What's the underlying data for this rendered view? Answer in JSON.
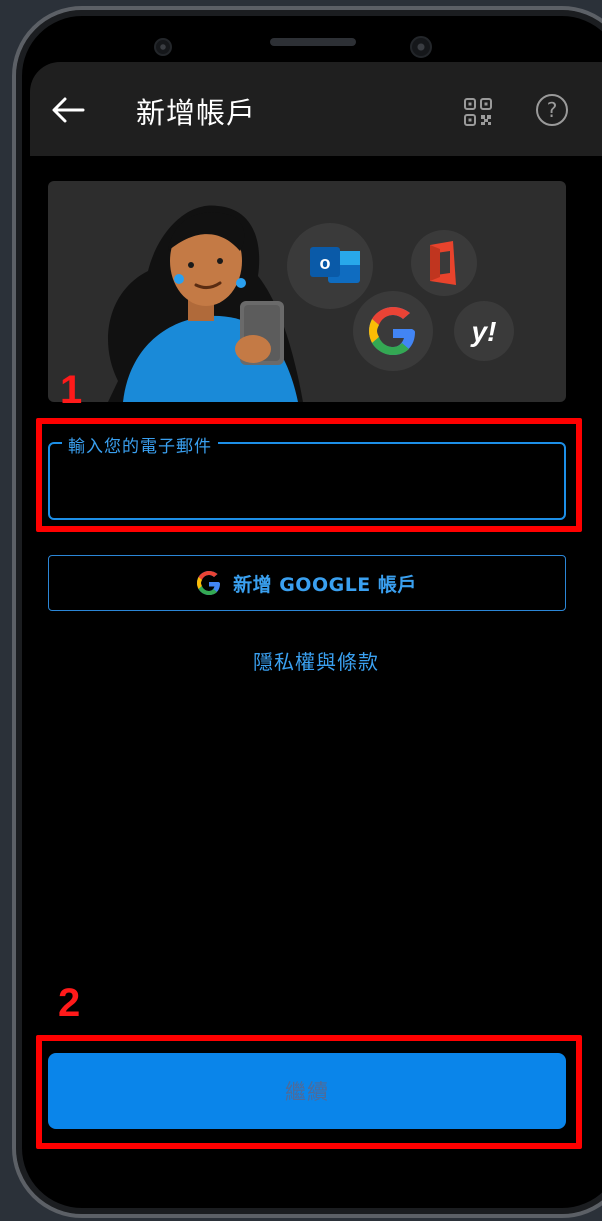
{
  "app_bar": {
    "title": "新增帳戶",
    "back_icon": "arrow-left-icon",
    "qr_icon": "qr-code-icon",
    "help_label": "?"
  },
  "hero": {
    "logos": [
      "outlook-logo",
      "office-logo",
      "google-logo",
      "yahoo-logo"
    ],
    "outlook_letter": "o",
    "yahoo_text": "y!"
  },
  "annotations": {
    "first": "1",
    "second": "2",
    "color": "#ff0000"
  },
  "email_field": {
    "label": "輸入您的電子郵件",
    "value": ""
  },
  "google_button": {
    "label": "新增 GOOGLE 帳戶"
  },
  "privacy_link": {
    "label": "隱私權與條款"
  },
  "continue_button": {
    "label": "繼續"
  },
  "colors": {
    "accent": "#0a85ea",
    "link": "#3aa0f0",
    "background": "#000000",
    "app_bar": "#1f1f1f"
  }
}
